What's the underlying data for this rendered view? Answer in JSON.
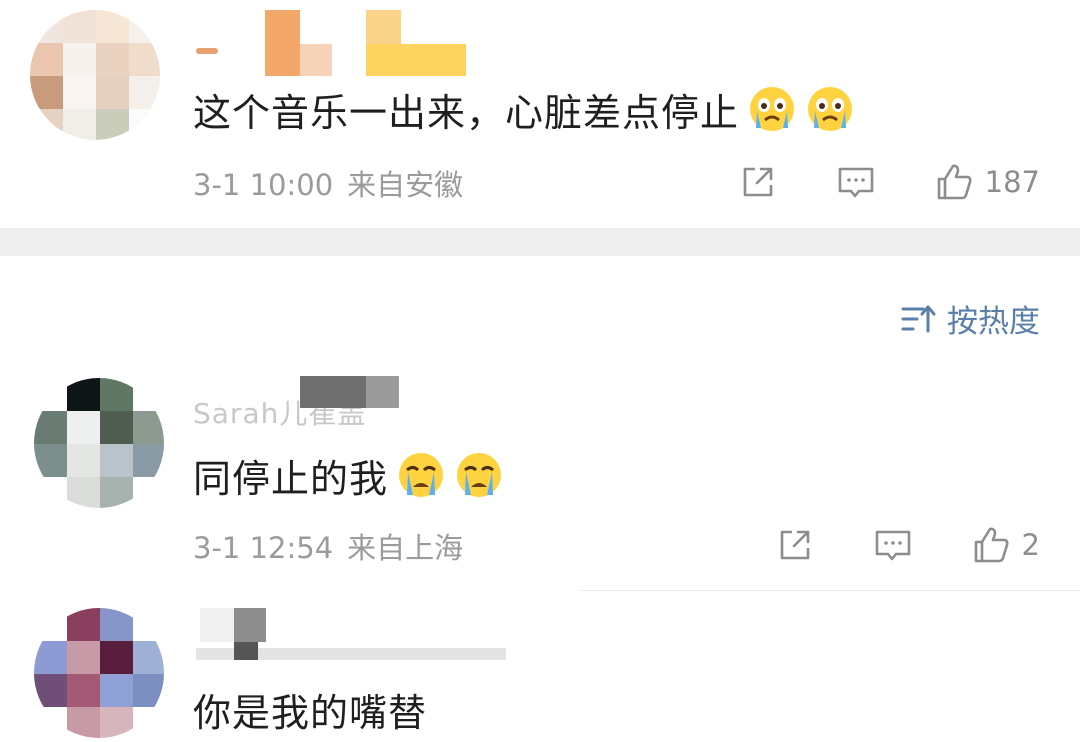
{
  "comments": [
    {
      "text": "这个音乐一出来，心脏差点停止",
      "emoji": "crying-face-emoji",
      "emoji_count": 2,
      "time": "3-1 10:00",
      "location": "来自安徽",
      "likes": "187"
    },
    {
      "name_partial": "Sarah儿崔盖",
      "text": "同停止的我",
      "emoji": "loudly-crying-face-emoji",
      "emoji_count": 2,
      "time": "3-1 12:54",
      "location": "来自上海",
      "likes": "2"
    },
    {
      "text": "你是我的嘴替"
    }
  ],
  "sort": {
    "label": "按热度",
    "icon": "sort-icon"
  },
  "icons": {
    "share": "share-icon",
    "comment": "comment-icon",
    "like": "like-icon"
  },
  "colors": {
    "text": "#1f1f1f",
    "meta": "#9b9b9b",
    "sort": "#5b7fa8",
    "divider": "#efefef",
    "icon": "#8d8d8d"
  }
}
